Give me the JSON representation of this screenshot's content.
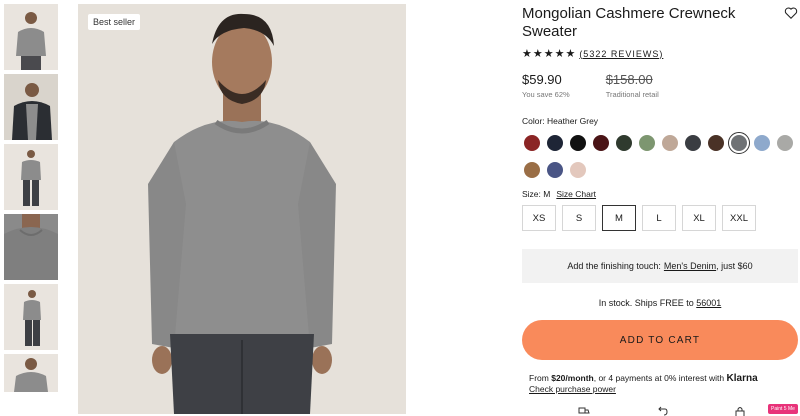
{
  "thumbnails": [
    {
      "name": "front-view"
    },
    {
      "name": "jacket-layered"
    },
    {
      "name": "full-body"
    },
    {
      "name": "neck-detail"
    },
    {
      "name": "full-body-side"
    },
    {
      "name": "front-crop"
    }
  ],
  "main_image": {
    "badge": "Best seller"
  },
  "product": {
    "title": "Mongolian Cashmere Crewneck Sweater",
    "stars": "★★★★★",
    "reviews": "(5322 REVIEWS)",
    "price": "$59.90",
    "savings": "You save 62%",
    "original_price": "$158.00",
    "original_label": "Traditional retail",
    "color_label": "Color: Heather Grey",
    "colors": [
      {
        "name": "red",
        "hex": "#8b2525"
      },
      {
        "name": "navy",
        "hex": "#1e2536"
      },
      {
        "name": "black",
        "hex": "#111111"
      },
      {
        "name": "burgundy",
        "hex": "#4a1416"
      },
      {
        "name": "forest",
        "hex": "#2f3a2e"
      },
      {
        "name": "sage",
        "hex": "#7d9670"
      },
      {
        "name": "taupe",
        "hex": "#bfa898"
      },
      {
        "name": "charcoal",
        "hex": "#3a3d42"
      },
      {
        "name": "chocolate",
        "hex": "#4a3226"
      },
      {
        "name": "heather-grey",
        "hex": "#6f7275",
        "selected": true
      },
      {
        "name": "light-blue",
        "hex": "#8ea9cc"
      },
      {
        "name": "light-grey",
        "hex": "#a9a9a6"
      },
      {
        "name": "camel",
        "hex": "#9a6e46"
      },
      {
        "name": "indigo",
        "hex": "#4a5585"
      },
      {
        "name": "blush",
        "hex": "#e3c8bd"
      }
    ],
    "size_label": "Size: M",
    "size_chart": "Size Chart",
    "sizes": [
      "XS",
      "S",
      "M",
      "L",
      "XL",
      "XXL"
    ],
    "selected_size": "M",
    "finishing": {
      "prefix": "Add the finishing touch:",
      "link": "Men's Denim",
      "suffix": ", just $60"
    },
    "stock": {
      "prefix": "In stock. Ships FREE to",
      "zip": "56001"
    },
    "cart_label": "ADD TO CART",
    "klarna": {
      "from": "From",
      "amount": "$20/month",
      "rest": ", or 4 payments at 0% interest with",
      "brand": "Klarna",
      "link": "Check purchase power"
    }
  },
  "paint_badge": "Paint 5 Me",
  "icons": [
    "heart-icon",
    "truck-icon",
    "return-icon",
    "lock-icon"
  ]
}
